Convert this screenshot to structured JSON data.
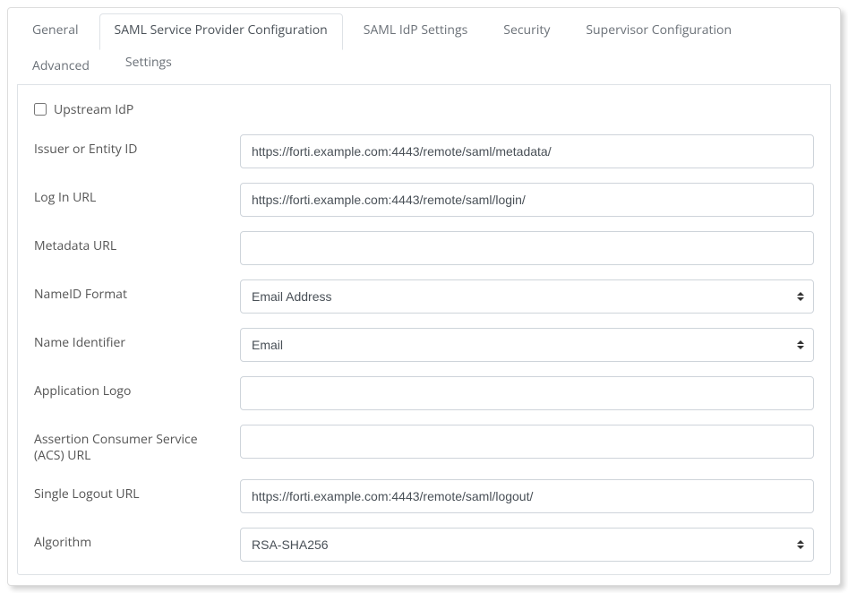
{
  "tabs": {
    "general": "General",
    "saml_sp": "SAML Service Provider Configuration",
    "saml_idp": "SAML IdP Settings",
    "security": "Security",
    "supervisor": "Supervisor Configuration",
    "advanced": "Advanced",
    "settings": "Settings"
  },
  "form": {
    "upstream_idp_label": "Upstream IdP",
    "issuer_label": "Issuer or Entity ID",
    "issuer_value": "https://forti.example.com:4443/remote/saml/metadata/",
    "login_label": "Log In URL",
    "login_value": "https://forti.example.com:4443/remote/saml/login/",
    "metadata_label": "Metadata URL",
    "metadata_value": "",
    "nameid_format_label": "NameID Format",
    "nameid_format_value": "Email Address",
    "name_identifier_label": "Name Identifier",
    "name_identifier_value": "Email",
    "app_logo_label": "Application Logo",
    "app_logo_value": "",
    "acs_label": "Assertion Consumer Service (ACS) URL",
    "acs_value": "",
    "slo_label": "Single Logout URL",
    "slo_value": "https://forti.example.com:4443/remote/saml/logout/",
    "algorithm_label": "Algorithm",
    "algorithm_value": "RSA-SHA256"
  }
}
